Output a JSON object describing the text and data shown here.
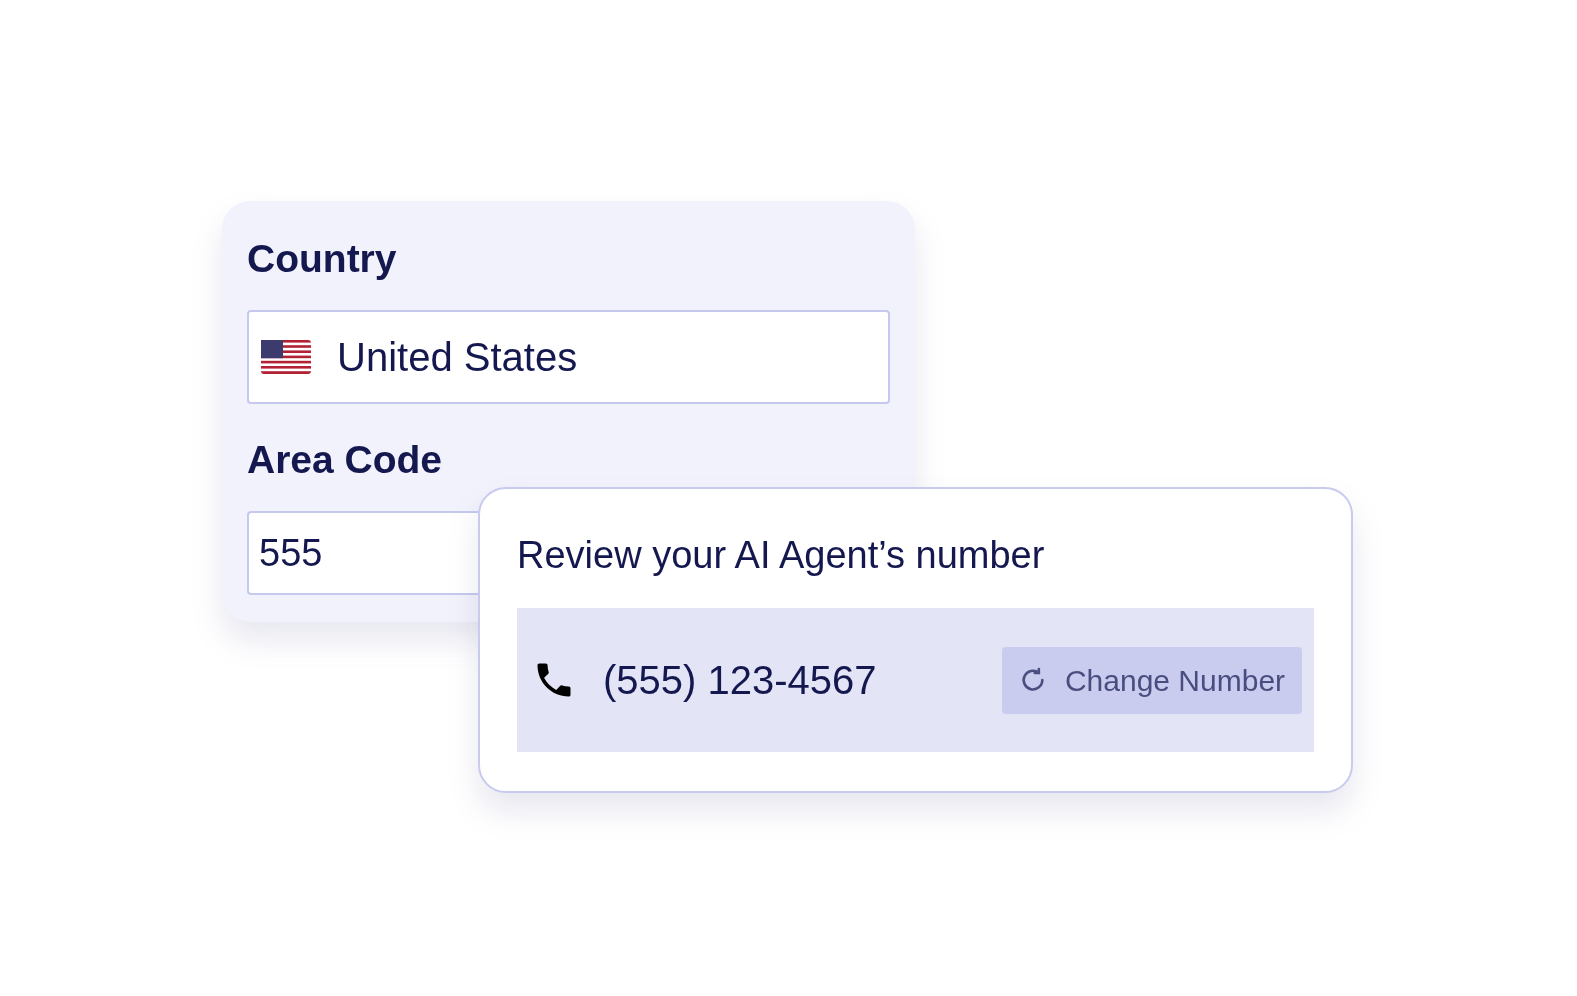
{
  "country": {
    "label": "Country",
    "value": "United States"
  },
  "area_code": {
    "label": "Area Code",
    "value": "555"
  },
  "review": {
    "title": "Review your AI Agent’s number",
    "number": "(555) 123-4567",
    "button": "Change Number"
  }
}
